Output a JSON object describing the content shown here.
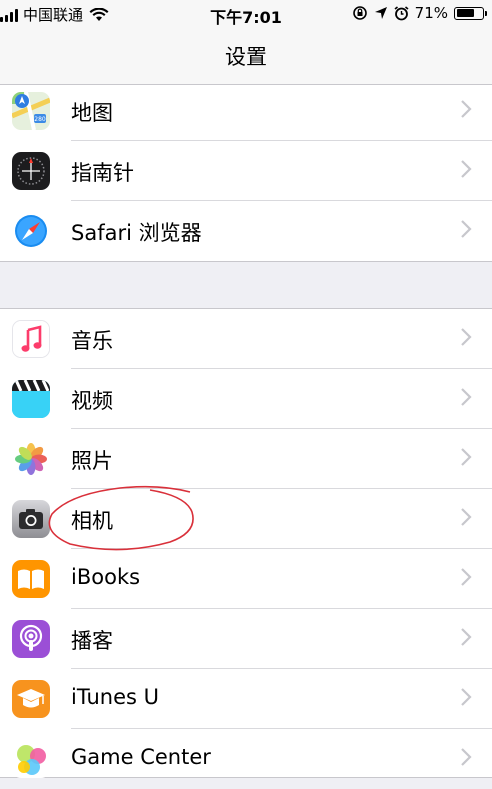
{
  "status_bar": {
    "carrier": "中国联通",
    "time": "下午7:01",
    "battery_percent": "71%",
    "battery_level": 0.71
  },
  "nav": {
    "title": "设置"
  },
  "group1": [
    {
      "label": "地图",
      "icon": "maps-icon"
    },
    {
      "label": "指南针",
      "icon": "compass-icon"
    },
    {
      "label": "Safari 浏览器",
      "icon": "safari-icon"
    }
  ],
  "group2": [
    {
      "label": "音乐",
      "icon": "music-icon"
    },
    {
      "label": "视频",
      "icon": "videos-icon"
    },
    {
      "label": "照片",
      "icon": "photos-icon"
    },
    {
      "label": "相机",
      "icon": "camera-icon"
    },
    {
      "label": "iBooks",
      "icon": "ibooks-icon"
    },
    {
      "label": "播客",
      "icon": "podcasts-icon"
    },
    {
      "label": "iTunes U",
      "icon": "itunes-u-icon"
    },
    {
      "label": "Game Center",
      "icon": "game-center-icon"
    }
  ],
  "colors": {
    "background": "#efeff4",
    "annotation": "#d9303a"
  }
}
